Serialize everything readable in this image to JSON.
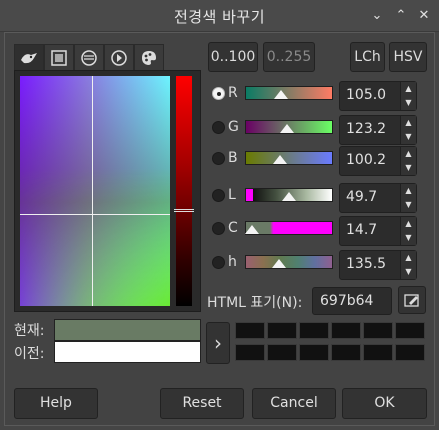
{
  "window": {
    "title": "전경색 바꾸기",
    "buttons": {
      "minimize": "⌄",
      "maximize": "⌃",
      "close": "✕"
    }
  },
  "tabs": [
    {
      "icon": "gimp-icon"
    },
    {
      "icon": "cmyk-icon"
    },
    {
      "icon": "watercolor-icon"
    },
    {
      "icon": "wheel-icon"
    },
    {
      "icon": "palette-icon"
    }
  ],
  "range_buttons": {
    "r100": "0..100",
    "r255": "0..255"
  },
  "mode_buttons": {
    "lch": "LCh",
    "hsv": "HSV"
  },
  "channels": [
    {
      "label": "R",
      "value": "105.0",
      "fraction": 0.41,
      "selected": true
    },
    {
      "label": "G",
      "value": "123.2",
      "fraction": 0.48,
      "selected": false
    },
    {
      "label": "B",
      "value": "100.2",
      "fraction": 0.39,
      "selected": false
    },
    {
      "label": "L",
      "value": "49.7",
      "fraction": 0.5,
      "selected": false
    },
    {
      "label": "C",
      "value": "14.7",
      "fraction": 0.07,
      "selected": false
    },
    {
      "label": "h",
      "value": "135.5",
      "fraction": 0.38,
      "selected": false
    }
  ],
  "html_notation": {
    "label": "HTML 표기(N):",
    "value": "697b64"
  },
  "current": {
    "label": "현재:",
    "color": "#697b64"
  },
  "previous": {
    "label": "이전:",
    "color": "#ffffff"
  },
  "history_arrow": "›",
  "footer": {
    "help": "Help",
    "reset": "Reset",
    "cancel": "Cancel",
    "ok": "OK"
  }
}
